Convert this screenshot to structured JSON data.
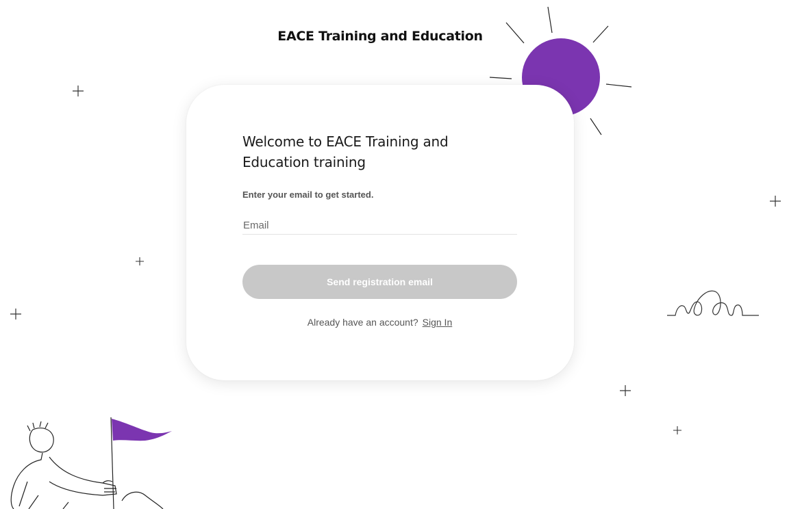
{
  "header": {
    "brand_title": "EACE Training and Education"
  },
  "card": {
    "welcome_heading": "Welcome to EACE Training and Education training",
    "instruction": "Enter your email to get started.",
    "email_placeholder": "Email",
    "email_value": "",
    "send_button_label": "Send registration email",
    "signin_prompt": "Already have an account?",
    "signin_link_label": "Sign In"
  },
  "colors": {
    "accent_purple": "#7b35b0",
    "button_disabled": "#c8c8c8"
  },
  "icons": [
    "sun-illustration",
    "plus-sparkle-icon",
    "squiggle-line-icon",
    "person-with-flag-illustration"
  ]
}
